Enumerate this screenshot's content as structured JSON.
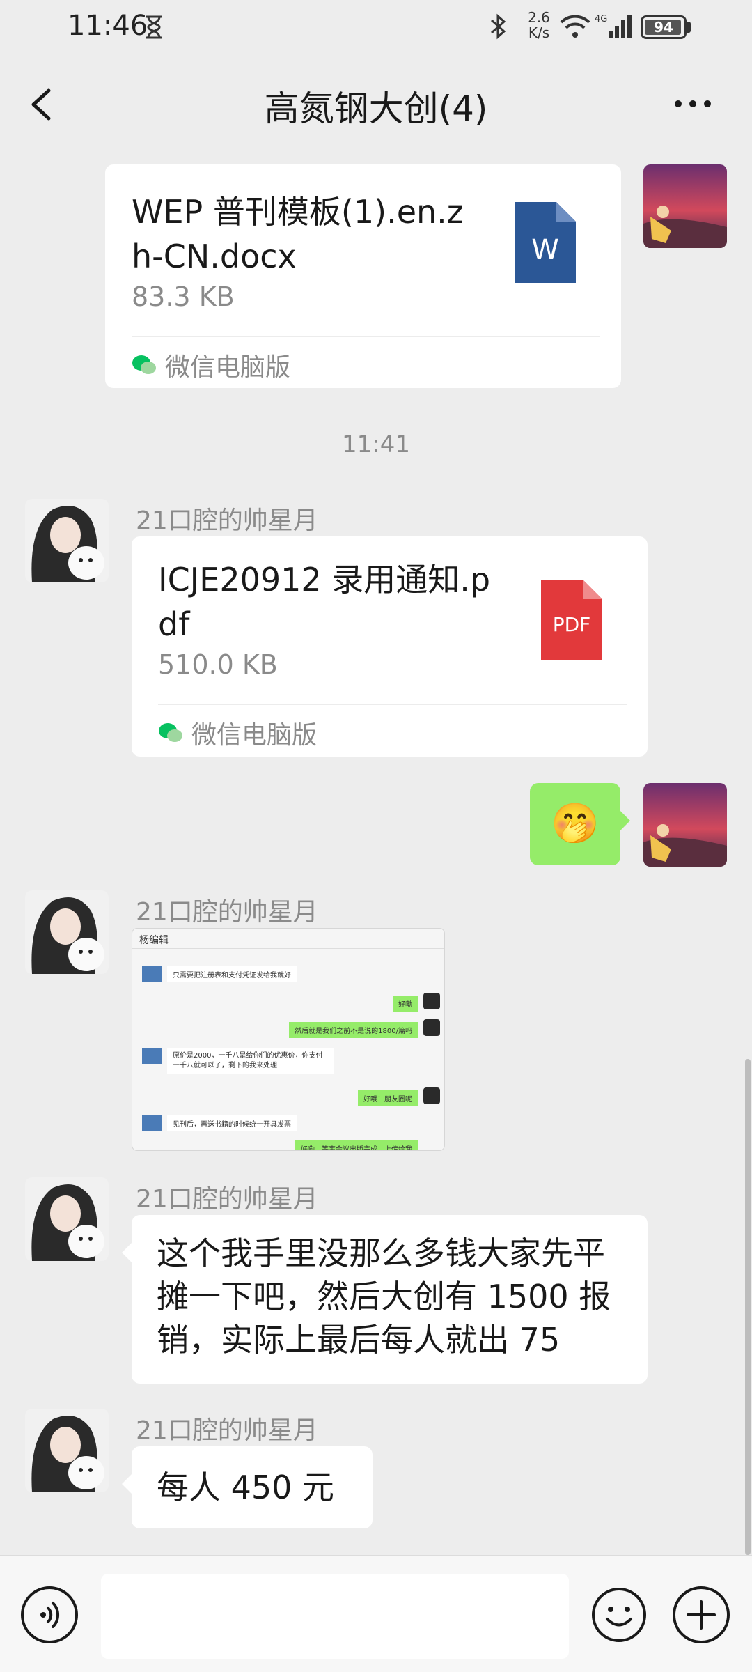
{
  "status_bar": {
    "time": "11:46",
    "net_speed_value": "2.6",
    "net_speed_unit": "K/s",
    "network": "4G",
    "battery": "94"
  },
  "header": {
    "title": "高氮钢大创(4)"
  },
  "messages": {
    "m1": {
      "file_name": "WEP 普刊模板(1).en.zh-CN.docx",
      "file_size": "83.3 KB",
      "source": "微信电脑版",
      "file_badge": "W"
    },
    "timestamp": "11:41",
    "m2": {
      "sender": "21口腔的帅星月",
      "file_name": "ICJE20912 录用通知.pdf",
      "file_size": "510.0 KB",
      "source": "微信电脑版",
      "file_badge": "PDF"
    },
    "m3": {
      "emoji": "🤭"
    },
    "m4": {
      "sender": "21口腔的帅星月",
      "shot_title": "杨编辑",
      "shot_lines": [
        "只需要把注册表和支付凭证发给我就好",
        "好嘞",
        "然后就是我们之前不是说的1800/篇吗",
        "原价是2000，一千八是给你们的优惠价，你支付一千八就可以了，剩下的我来处理",
        "好哦！朋友圈呢",
        "见刊后，再送书籍的时候统一开具发票",
        "好嘞，等事会议出版完成，上传给我"
      ]
    },
    "m5": {
      "sender": "21口腔的帅星月",
      "text": "这个我手里没那么多钱大家先平摊一下吧，然后大创有 1500 报销，实际上最后每人就出 75"
    },
    "m6": {
      "sender": "21口腔的帅星月",
      "text": "每人 450 元"
    }
  },
  "input_bar": {
    "placeholder": ""
  },
  "icons": {
    "back": "back-arrow-icon",
    "more": "more-icon",
    "voice": "voice-icon",
    "emoji": "emoji-icon",
    "plus": "plus-icon",
    "word": "word-file-icon",
    "pdf": "pdf-file-icon",
    "wechat": "wechat-icon"
  },
  "colors": {
    "background": "#ededed",
    "bubble": "#ffffff",
    "self_bubble": "#95ec69",
    "word_blue": "#2b5796",
    "pdf_red": "#e2393b",
    "muted": "#8a8a8a"
  }
}
